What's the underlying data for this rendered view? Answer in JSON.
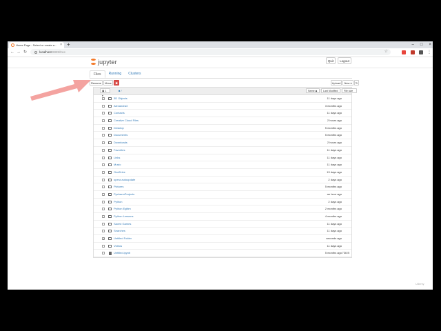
{
  "browser": {
    "tab_title": "Home Page - Select or create a...",
    "new_tab_symbol": "+",
    "window_controls": [
      "–",
      "□",
      "×"
    ],
    "url_host": "localhost",
    "url_path": ":8889/tree",
    "nav": {
      "back": "←",
      "forward": "→",
      "reload": "↻"
    },
    "extension_colors": [
      "#e8453c",
      "#c0392b",
      "#555555"
    ]
  },
  "jupyter": {
    "logo_text": "jupyter",
    "quit_label": "Quit",
    "logout_label": "Logout",
    "tabs": [
      "Files",
      "Running",
      "Clusters"
    ],
    "toolbar": {
      "rename": "Rename",
      "move": "Move",
      "delete_icon": "🗑",
      "upload": "Upload",
      "new": "New ▾",
      "refresh": "↻"
    },
    "list_header": {
      "selected_count": "1",
      "folder_icon": "■",
      "breadcrumb_sep": "/",
      "name_sort": "Name ◆",
      "last_modified": "Last Modified",
      "file_size": "File size"
    },
    "items": [
      {
        "name": "3D Objects",
        "time": "11 days ago",
        "size": "",
        "type": "folder",
        "checked": false
      },
      {
        "name": "Alexandra3",
        "time": "3 months ago",
        "size": "",
        "type": "folder",
        "checked": false
      },
      {
        "name": "Contacts",
        "time": "11 days ago",
        "size": "",
        "type": "folder",
        "checked": false
      },
      {
        "name": "Creative Cloud Files",
        "time": "2 hours ago",
        "size": "",
        "type": "folder",
        "checked": false
      },
      {
        "name": "Desktop",
        "time": "5 months ago",
        "size": "",
        "type": "folder",
        "checked": false
      },
      {
        "name": "Documents",
        "time": "5 months ago",
        "size": "",
        "type": "folder",
        "checked": false
      },
      {
        "name": "Downloads",
        "time": "2 hours ago",
        "size": "",
        "type": "folder",
        "checked": false
      },
      {
        "name": "Favorites",
        "time": "11 days ago",
        "size": "",
        "type": "folder",
        "checked": false
      },
      {
        "name": "Links",
        "time": "11 days ago",
        "size": "",
        "type": "folder",
        "checked": false
      },
      {
        "name": "Music",
        "time": "11 days ago",
        "size": "",
        "type": "folder",
        "checked": false
      },
      {
        "name": "OneDrive",
        "time": "13 days ago",
        "size": "",
        "type": "folder",
        "checked": false
      },
      {
        "name": "opera autoupdate",
        "time": "2 days ago",
        "size": "",
        "type": "folder",
        "checked": false
      },
      {
        "name": "Pictures",
        "time": "5 months ago",
        "size": "",
        "type": "folder",
        "checked": false
      },
      {
        "name": "PycharmProjects",
        "time": "an hour ago",
        "size": "",
        "type": "folder",
        "checked": false
      },
      {
        "name": "Python",
        "time": "2 days ago",
        "size": "",
        "type": "folder",
        "checked": false
      },
      {
        "name": "Python Egitim",
        "time": "2 months ago",
        "size": "",
        "type": "folder",
        "checked": false
      },
      {
        "name": "Python Lessons",
        "time": "4 months ago",
        "size": "",
        "type": "folder",
        "checked": false
      },
      {
        "name": "Saved Games",
        "time": "11 days ago",
        "size": "",
        "type": "folder",
        "checked": false
      },
      {
        "name": "Searches",
        "time": "11 days ago",
        "size": "",
        "type": "folder",
        "checked": false
      },
      {
        "name": "Untitled Folder",
        "time": "seconds ago",
        "size": "",
        "type": "folder",
        "checked": true
      },
      {
        "name": "Videos",
        "time": "11 days ago",
        "size": "",
        "type": "folder",
        "checked": false
      },
      {
        "name": "Untitled.ipynb",
        "time": "5 months ago",
        "size": "736 B",
        "type": "notebook",
        "checked": false
      }
    ]
  },
  "overlay": {
    "arrow_color": "#f4a3a0",
    "watermark": "Udemy"
  }
}
